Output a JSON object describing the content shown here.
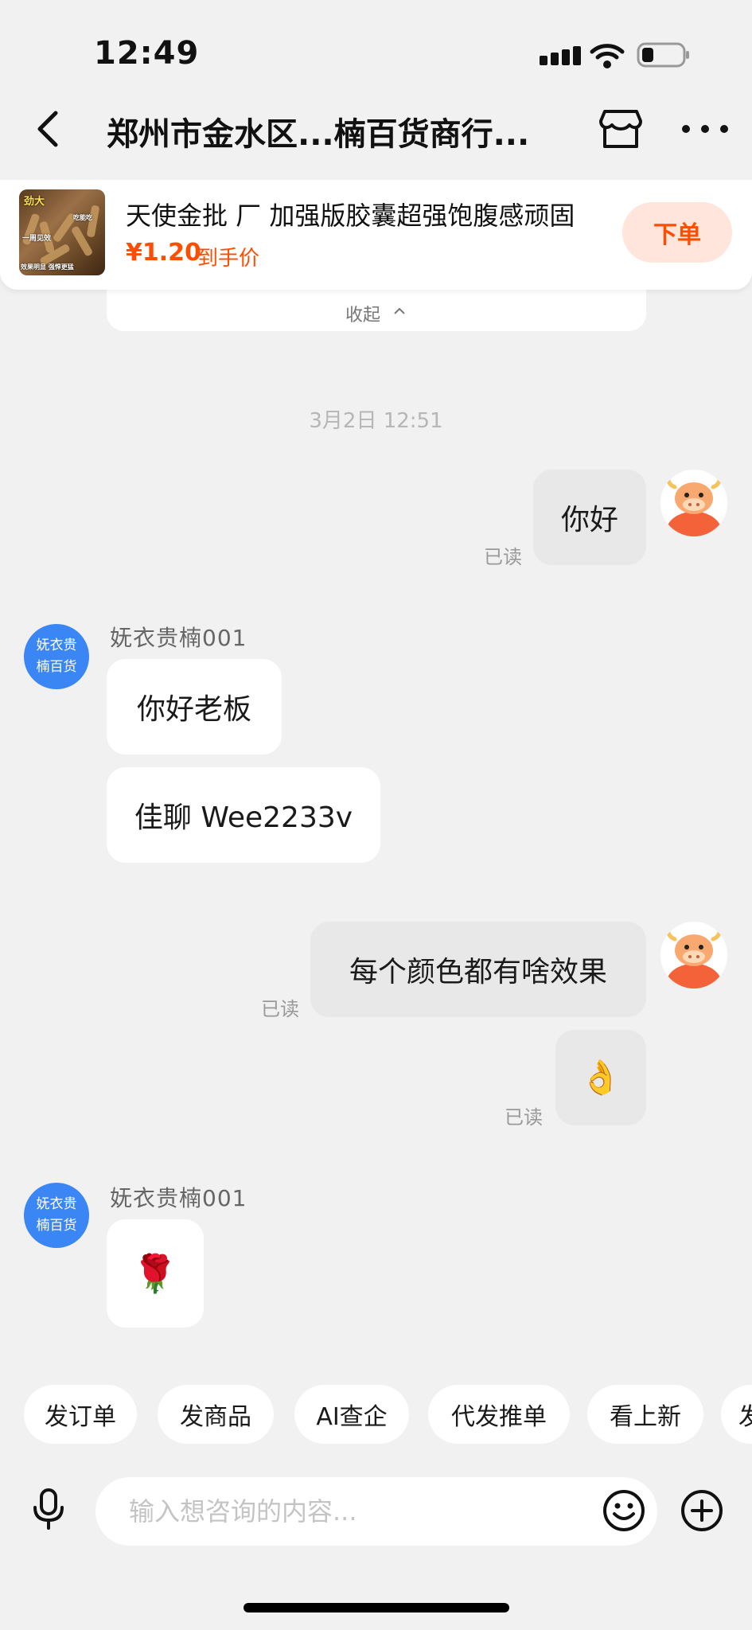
{
  "status_bar": {
    "time": "12:49"
  },
  "header": {
    "title": "郑州市金水区...楠百货商行..."
  },
  "product": {
    "title": "天使金批 厂 加强版胶囊超强饱腹感顽固",
    "price": "¥1.20",
    "price_label": "到手价",
    "order_label": "下单",
    "thumb_texts": [
      "劲大",
      "一周见效",
      "效果明显 强悍更猛",
      "吃能吃"
    ]
  },
  "collapse_label": "收起",
  "timestamp": "3月2日 12:51",
  "messages": [
    {
      "from": "me",
      "text": "你好",
      "read": "已读"
    },
    {
      "from": "shop",
      "sender": "妩衣贵楠001",
      "avatar_line1": "妩衣贵",
      "avatar_line2": "楠百货",
      "text": "你好老板"
    },
    {
      "from": "shop",
      "text": "佳聊 Wee2233v"
    },
    {
      "from": "me",
      "text": "每个颜色都有啥效果",
      "read": "已读"
    },
    {
      "from": "me",
      "text": "👌",
      "read": "已读"
    },
    {
      "from": "shop",
      "sender": "妩衣贵楠001",
      "avatar_line1": "妩衣贵",
      "avatar_line2": "楠百货",
      "text": "🌹"
    }
  ],
  "quick_actions": [
    "发订单",
    "发商品",
    "AI查企",
    "代发推单",
    "看上新",
    "发"
  ],
  "input": {
    "placeholder": "输入想咨询的内容..."
  },
  "colors": {
    "accent": "#ff4d00",
    "avatar_blue": "#3b86f5",
    "bubble_me": "#e8e8e8"
  }
}
